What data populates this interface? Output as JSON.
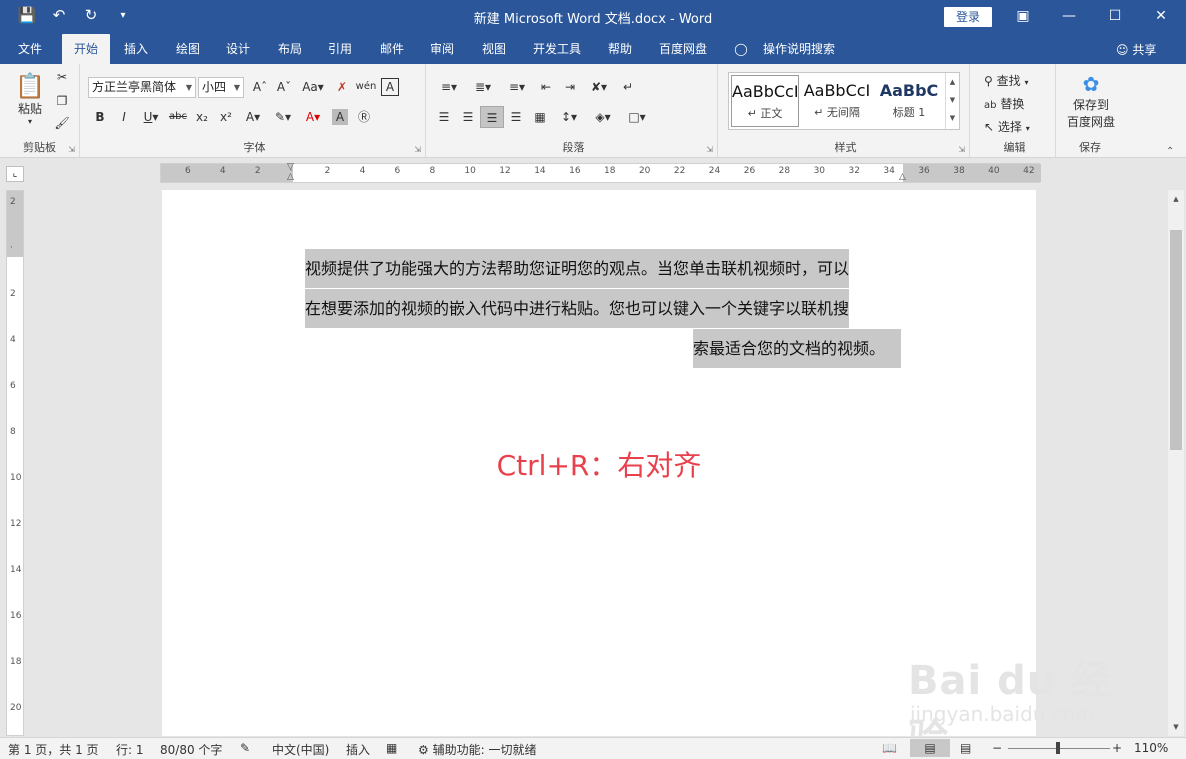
{
  "window": {
    "title": "新建 Microsoft Word 文档.docx  -  Word",
    "login": "登录"
  },
  "tabs": [
    "文件",
    "开始",
    "插入",
    "绘图",
    "设计",
    "布局",
    "引用",
    "邮件",
    "审阅",
    "视图",
    "开发工具",
    "帮助",
    "百度网盘",
    "操作说明搜索"
  ],
  "share": "共享",
  "ribbon": {
    "clipboard": {
      "paste": "粘贴",
      "label": "剪贴板"
    },
    "font": {
      "name": "方正兰亭黑简体",
      "size": "小四",
      "label": "字体"
    },
    "paragraph": {
      "label": "段落"
    },
    "styles": {
      "label": "样式",
      "items": [
        {
          "sample": "AaBbCcI",
          "name": "↵ 正文"
        },
        {
          "sample": "AaBbCcI",
          "name": "↵ 无间隔"
        },
        {
          "sample": "AaBbC",
          "name": "标题 1"
        }
      ]
    },
    "editing": {
      "find": "查找",
      "replace": "替换",
      "select": "选择",
      "label": "编辑"
    },
    "save": {
      "line1": "保存到",
      "line2": "百度网盘",
      "label": "保存"
    }
  },
  "ruler": {
    "h_numbers": [
      "6",
      "4",
      "2",
      "",
      "2",
      "4",
      "6",
      "8",
      "10",
      "12",
      "14",
      "16",
      "18",
      "20",
      "22",
      "24",
      "26",
      "28",
      "30",
      "32",
      "34",
      "36",
      "38",
      "40",
      "42"
    ],
    "v_numbers": [
      "2",
      "",
      "2",
      "4",
      "6",
      "8",
      "10",
      "12",
      "14",
      "16",
      "18",
      "20"
    ]
  },
  "document": {
    "line1": "视频提供了功能强大的方法帮助您证明您的观点。当您单击联机视频时，可以",
    "line2": "在想要添加的视频的嵌入代码中进行粘贴。您也可以键入一个关键字以联机搜",
    "line3": "索最适合您的文档的视频。",
    "caption": "Ctrl+R：右对齐"
  },
  "watermark": {
    "main": "Bai du 经验",
    "sub": "jingyan.baidu.com"
  },
  "statusbar": {
    "page": "第 1 页，共 1 页",
    "line": "行: 1",
    "words": "80/80 个字",
    "lang": "中文(中国)",
    "mode": "插入",
    "accessibility": "辅助功能: 一切就绪",
    "zoom": "110%"
  }
}
